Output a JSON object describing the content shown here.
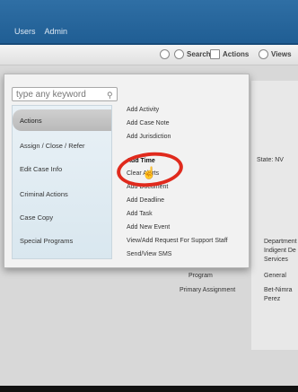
{
  "topnav": {
    "items": [
      "Users",
      "Admin"
    ]
  },
  "toolbar": {
    "search": "Search",
    "actions": "Actions",
    "views": "Views"
  },
  "search": {
    "placeholder": "type any keyword"
  },
  "categories": [
    "Actions",
    "Assign / Close / Refer",
    "Edit Case Info",
    "Criminal Actions",
    "Case Copy",
    "Special Programs"
  ],
  "items": [
    "Add Activity",
    "Add Case Note",
    "Add Jurisdiction",
    "Add Time",
    "Clear Alerts",
    "Add Document",
    "Add Deadline",
    "Add Task",
    "Add New Event",
    "View/Add Request For Support Staff",
    "Send/View SMS"
  ],
  "background": {
    "state": "State: NV",
    "department_lines": [
      "Department",
      "Indigent De",
      "Services"
    ],
    "program_label": "Program",
    "program_value": "General",
    "primary_assignment_label": "Primary Assignment",
    "primary_assignment_value_lines": [
      "Bet-Nimra",
      "Perez"
    ]
  }
}
